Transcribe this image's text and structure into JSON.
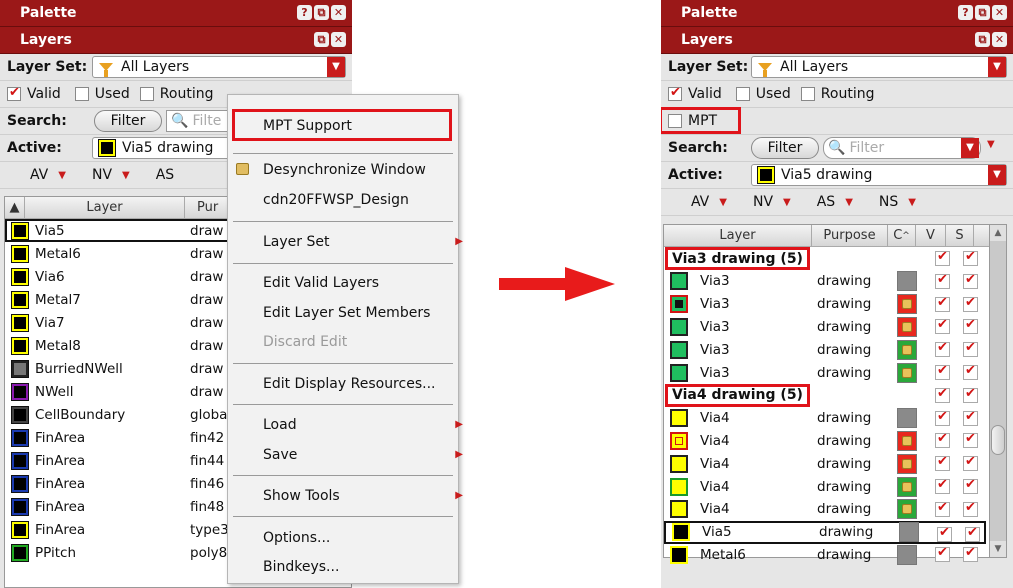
{
  "left": {
    "palette_title": "Palette",
    "layers_title": "Layers",
    "title_buttons": [
      "?",
      "⧉",
      "✕"
    ],
    "layer_set_label": "Layer Set:",
    "layer_set_value": "All Layers",
    "checks": [
      {
        "label": "Valid",
        "checked": true
      },
      {
        "label": "Used",
        "checked": false
      },
      {
        "label": "Routing",
        "checked": false
      }
    ],
    "search_label": "Search:",
    "filter_button": "Filter",
    "filter_placeholder": "Filte",
    "active_label": "Active:",
    "active_value": "Via5 drawing",
    "filters": [
      "AV",
      "NV",
      "AS"
    ],
    "col_layer": "Layer",
    "col_purpose": "Pur",
    "rows": [
      {
        "name": "Via5",
        "purpose": "draw",
        "color": "#000000",
        "border": "#ffff00"
      },
      {
        "name": "Metal6",
        "purpose": "draw",
        "color": "#000000",
        "border": "#ffff00"
      },
      {
        "name": "Via6",
        "purpose": "draw",
        "color": "#000000",
        "border": "#ffff00"
      },
      {
        "name": "Metal7",
        "purpose": "draw",
        "color": "#000000",
        "border": "#ffff00"
      },
      {
        "name": "Via7",
        "purpose": "draw",
        "color": "#000000",
        "border": "#ffff00"
      },
      {
        "name": "Metal8",
        "purpose": "draw",
        "color": "#000000",
        "border": "#ffff00"
      },
      {
        "name": "BurriedNWell",
        "purpose": "draw",
        "color": "#777777",
        "border": "#222222"
      },
      {
        "name": "NWell",
        "purpose": "draw",
        "color": "#000000",
        "border": "#8a1ab0"
      },
      {
        "name": "CellBoundary",
        "purpose": "globa",
        "color": "#000000",
        "border": "#444444"
      },
      {
        "name": "FinArea",
        "purpose": "fin42",
        "color": "#000000",
        "border": "#1a3ab0"
      },
      {
        "name": "FinArea",
        "purpose": "fin44",
        "color": "#000000",
        "border": "#1a3ab0"
      },
      {
        "name": "FinArea",
        "purpose": "fin46",
        "color": "#000000",
        "border": "#1a3ab0"
      },
      {
        "name": "FinArea",
        "purpose": "fin48",
        "color": "#000000",
        "border": "#1a3ab0"
      },
      {
        "name": "FinArea",
        "purpose": "type3",
        "color": "#000000",
        "border": "#ffff00"
      },
      {
        "name": "PPitch",
        "purpose": "poly8",
        "color": "#000000",
        "border": "#22aa22"
      }
    ]
  },
  "menu": {
    "items": {
      "mpt_support": "MPT Support",
      "desync": "Desynchronize Window",
      "design": "cdn20FFWSP_Design",
      "layer_set": "Layer Set",
      "edit_valid": "Edit Valid Layers",
      "edit_members": "Edit Layer Set Members",
      "discard": "Discard Edit",
      "edit_display": "Edit Display Resources...",
      "load": "Load",
      "save": "Save",
      "show_tools": "Show Tools",
      "options": "Options...",
      "bindkeys": "Bindkeys..."
    }
  },
  "right": {
    "palette_title": "Palette",
    "layers_title": "Layers",
    "layer_set_label": "Layer Set:",
    "layer_set_value": "All Layers",
    "checks": [
      {
        "label": "Valid",
        "checked": true
      },
      {
        "label": "Used",
        "checked": false
      },
      {
        "label": "Routing",
        "checked": false
      }
    ],
    "mpt_label": "MPT",
    "search_label": "Search:",
    "filter_button": "Filter",
    "filter_placeholder": "Filter",
    "active_label": "Active:",
    "active_value": "Via5 drawing",
    "filters": [
      "AV",
      "NV",
      "AS",
      "NS"
    ],
    "col_layer": "Layer",
    "col_purpose": "Purpose",
    "col_c": "C",
    "col_v": "V",
    "col_s": "S",
    "group1": "Via3 drawing (5)",
    "group2": "Via4 drawing (5)",
    "via3_name": "Via3",
    "via4_name": "Via4",
    "via5_name": "Via5",
    "metal6_name": "Metal6",
    "purpose": "drawing"
  },
  "colors": {
    "title_red": "#9b1818",
    "highlight_red": "#e0131a",
    "via3_green": "#1fbf5f",
    "via4_yellow": "#ffff00"
  }
}
